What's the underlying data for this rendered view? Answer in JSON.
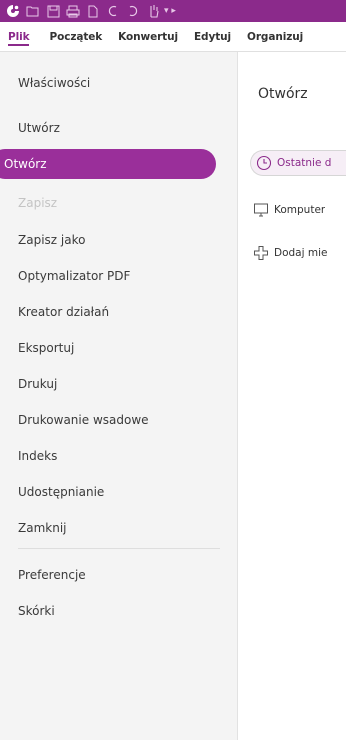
{
  "colors": {
    "accent": "#8b2a8b",
    "accent_light": "#9a2f9a",
    "menu_bg": "#f4f4f4"
  },
  "quick_access": {
    "icons": [
      "app-logo-icon",
      "open-folder-icon",
      "save-icon",
      "print-icon",
      "new-document-icon",
      "undo-icon",
      "redo-icon",
      "hand-tool-icon",
      "customize-toolbar-icon"
    ]
  },
  "ribbon": {
    "tabs": [
      {
        "label": "Plik",
        "active": true
      },
      {
        "label": "Początek"
      },
      {
        "label": "Konwertuj"
      },
      {
        "label": "Edytuj"
      },
      {
        "label": "Organizuj"
      }
    ]
  },
  "backstage": {
    "items": [
      {
        "label": "Właściwości"
      },
      {
        "label": "Utwórz"
      },
      {
        "label": "Otwórz",
        "active": true
      },
      {
        "label": "Zapisz",
        "disabled": true
      },
      {
        "label": "Zapisz jako"
      },
      {
        "label": "Optymalizator PDF"
      },
      {
        "label": "Kreator działań"
      },
      {
        "label": "Eksportuj"
      },
      {
        "label": "Drukuj"
      },
      {
        "label": "Drukowanie wsadowe"
      },
      {
        "label": "Indeks"
      },
      {
        "label": "Udostępnianie"
      },
      {
        "label": "Zamknij"
      },
      {
        "label": "Preferencje"
      },
      {
        "label": "Skórki"
      }
    ]
  },
  "open_pane": {
    "title": "Otwórz",
    "options": [
      {
        "label": "Ostatnie d",
        "icon": "clock-icon",
        "active": true
      },
      {
        "label": "Komputer",
        "icon": "computer-icon"
      },
      {
        "label": "Dodaj mie",
        "icon": "add-place-icon"
      }
    ]
  }
}
